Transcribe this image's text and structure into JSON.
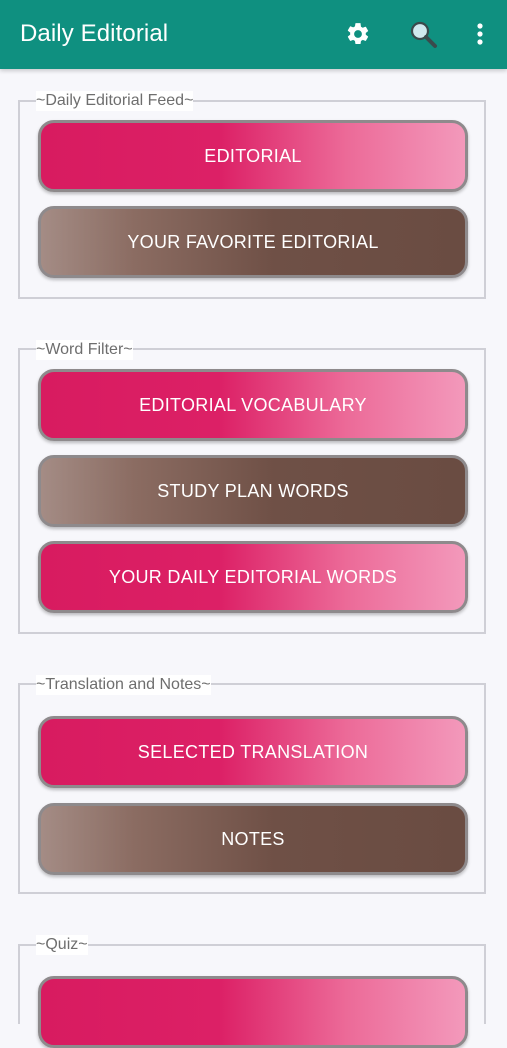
{
  "appbar": {
    "title": "Daily Editorial",
    "icons": [
      "gear-icon",
      "search-icon",
      "more-vert-icon"
    ],
    "color": "#0f9080"
  },
  "sections": [
    {
      "label": "~Daily Editorial Feed~",
      "buttons": [
        "EDITORIAL",
        "YOUR FAVORITE EDITORIAL"
      ]
    },
    {
      "label": "~Word Filter~",
      "buttons": [
        "EDITORIAL VOCABULARY",
        "STUDY PLAN WORDS",
        "YOUR DAILY EDITORIAL WORDS"
      ]
    },
    {
      "label": "~Translation and Notes~",
      "buttons": [
        "SELECTED TRANSLATION",
        "NOTES"
      ]
    },
    {
      "label": "~Quiz~",
      "buttons": [
        ""
      ]
    }
  ],
  "colors": {
    "pink": "#d81b60",
    "brown": "#6d4c41",
    "border": "#8e8a8c"
  }
}
